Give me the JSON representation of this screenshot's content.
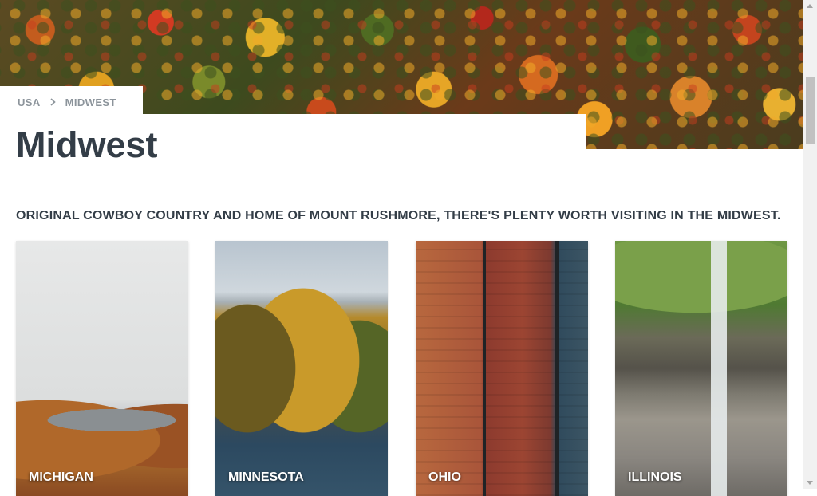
{
  "breadcrumb": {
    "items": [
      "USA",
      "MIDWEST"
    ],
    "separator_icon": "chevron-right-icon"
  },
  "page": {
    "title": "Midwest",
    "tagline": "ORIGINAL COWBOY COUNTRY AND HOME OF MOUNT RUSHMORE, THERE'S PLENTY WORTH VISITING IN THE MIDWEST."
  },
  "hero": {
    "image": "autumn-forest-aerial"
  },
  "cards": [
    {
      "label": "MICHIGAN",
      "image": "lake-valley-autumn"
    },
    {
      "label": "MINNESOTA",
      "image": "lakeshore-autumn-forest"
    },
    {
      "label": "OHIO",
      "image": "brick-buildings-street"
    },
    {
      "label": "ILLINOIS",
      "image": "canyon-waterfall"
    }
  ],
  "colors": {
    "heading": "#333d47",
    "breadcrumb_text": "#8c949b",
    "card_label": "#ffffff"
  }
}
